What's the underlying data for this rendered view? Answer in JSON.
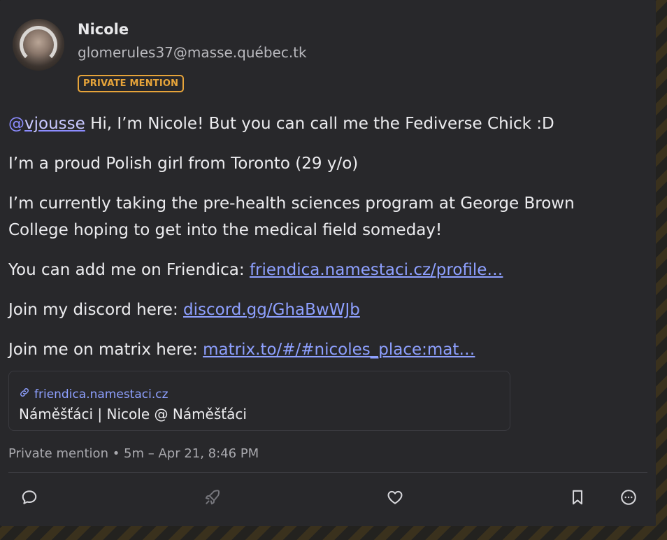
{
  "author": {
    "name": "Nicole",
    "handle": "glomerules37@masse.québec.tk",
    "badge": "PRIVATE MENTION"
  },
  "post": {
    "mention_prefix": "@",
    "mention_user": "vjousse",
    "line1_rest": " Hi, I’m Nicole! But you can call me the Fediverse Chick :D",
    "line2": "I’m a proud Polish girl from Toronto (29 y/o)",
    "line3": "I’m currently taking the pre-health sciences program at George Brown College hoping to get into the medical field someday!",
    "line4_prefix": "You can add me on Friendica: ",
    "line4_link": "friendica.namestaci.cz/profile…",
    "line5_prefix": "Join my discord here: ",
    "line5_link": "discord.gg/GhaBwWJb",
    "line6_prefix": "Join me on matrix here: ",
    "line6_link": "matrix.to/#/#nicoles_place:mat…"
  },
  "link_preview": {
    "host": "friendica.namestaci.cz",
    "title": "Náměšťáci | Nicole @ Náměšťáci"
  },
  "meta": {
    "visibility": "Private mention",
    "separator": " • ",
    "time": "5m – Apr 21, 8:46 PM"
  },
  "actions": {
    "icons": [
      "reply-icon",
      "boost-icon",
      "favourite-icon",
      "bookmark-icon",
      "more-icon"
    ]
  },
  "colors": {
    "card_bg": "#28282b",
    "accent_badge": "#e7a43a",
    "link": "#8ea0ff",
    "mention": "#8c8cff"
  }
}
